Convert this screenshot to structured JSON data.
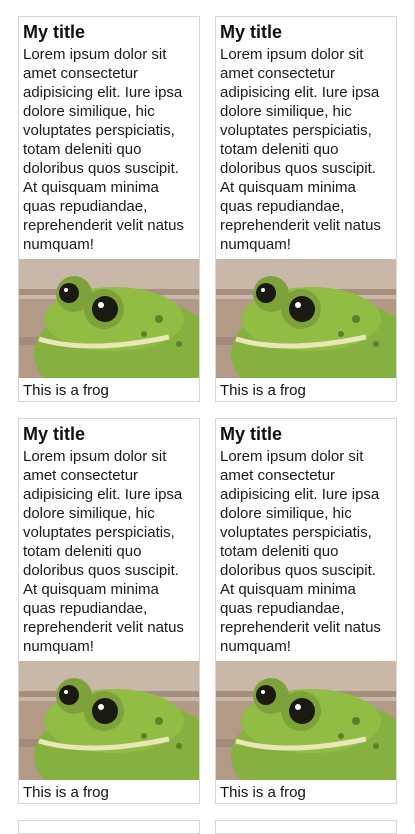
{
  "cards": [
    {
      "title": "My title",
      "body": "Lorem ipsum dolor sit amet consectetur adipisicing elit. Iure ipsa dolore similique, hic voluptates perspiciatis, totam deleniti quo doloribus quos suscipit. At quisquam minima quas repudiandae, reprehenderit velit natus numquam!",
      "caption": "This is a frog",
      "image": "frog"
    },
    {
      "title": "My title",
      "body": "Lorem ipsum dolor sit amet consectetur adipisicing elit. Iure ipsa dolore similique, hic voluptates perspiciatis, totam deleniti quo doloribus quos suscipit. At quisquam minima quas repudiandae, reprehenderit velit natus numquam!",
      "caption": "This is a frog",
      "image": "frog"
    },
    {
      "title": "My title",
      "body": "Lorem ipsum dolor sit amet consectetur adipisicing elit. Iure ipsa dolore similique, hic voluptates perspiciatis, totam deleniti quo doloribus quos suscipit. At quisquam minima quas repudiandae, reprehenderit velit natus numquam!",
      "caption": "This is a frog",
      "image": "frog"
    },
    {
      "title": "My title",
      "body": "Lorem ipsum dolor sit amet consectetur adipisicing elit. Iure ipsa dolore similique, hic voluptates perspiciatis, totam deleniti quo doloribus quos suscipit. At quisquam minima quas repudiandae, reprehenderit velit natus numquam!",
      "caption": "This is a frog",
      "image": "frog"
    }
  ],
  "colors": {
    "card_border": "#d6d6d6",
    "frog_green": "#7fae3a",
    "background_wood": "#b39a86"
  }
}
